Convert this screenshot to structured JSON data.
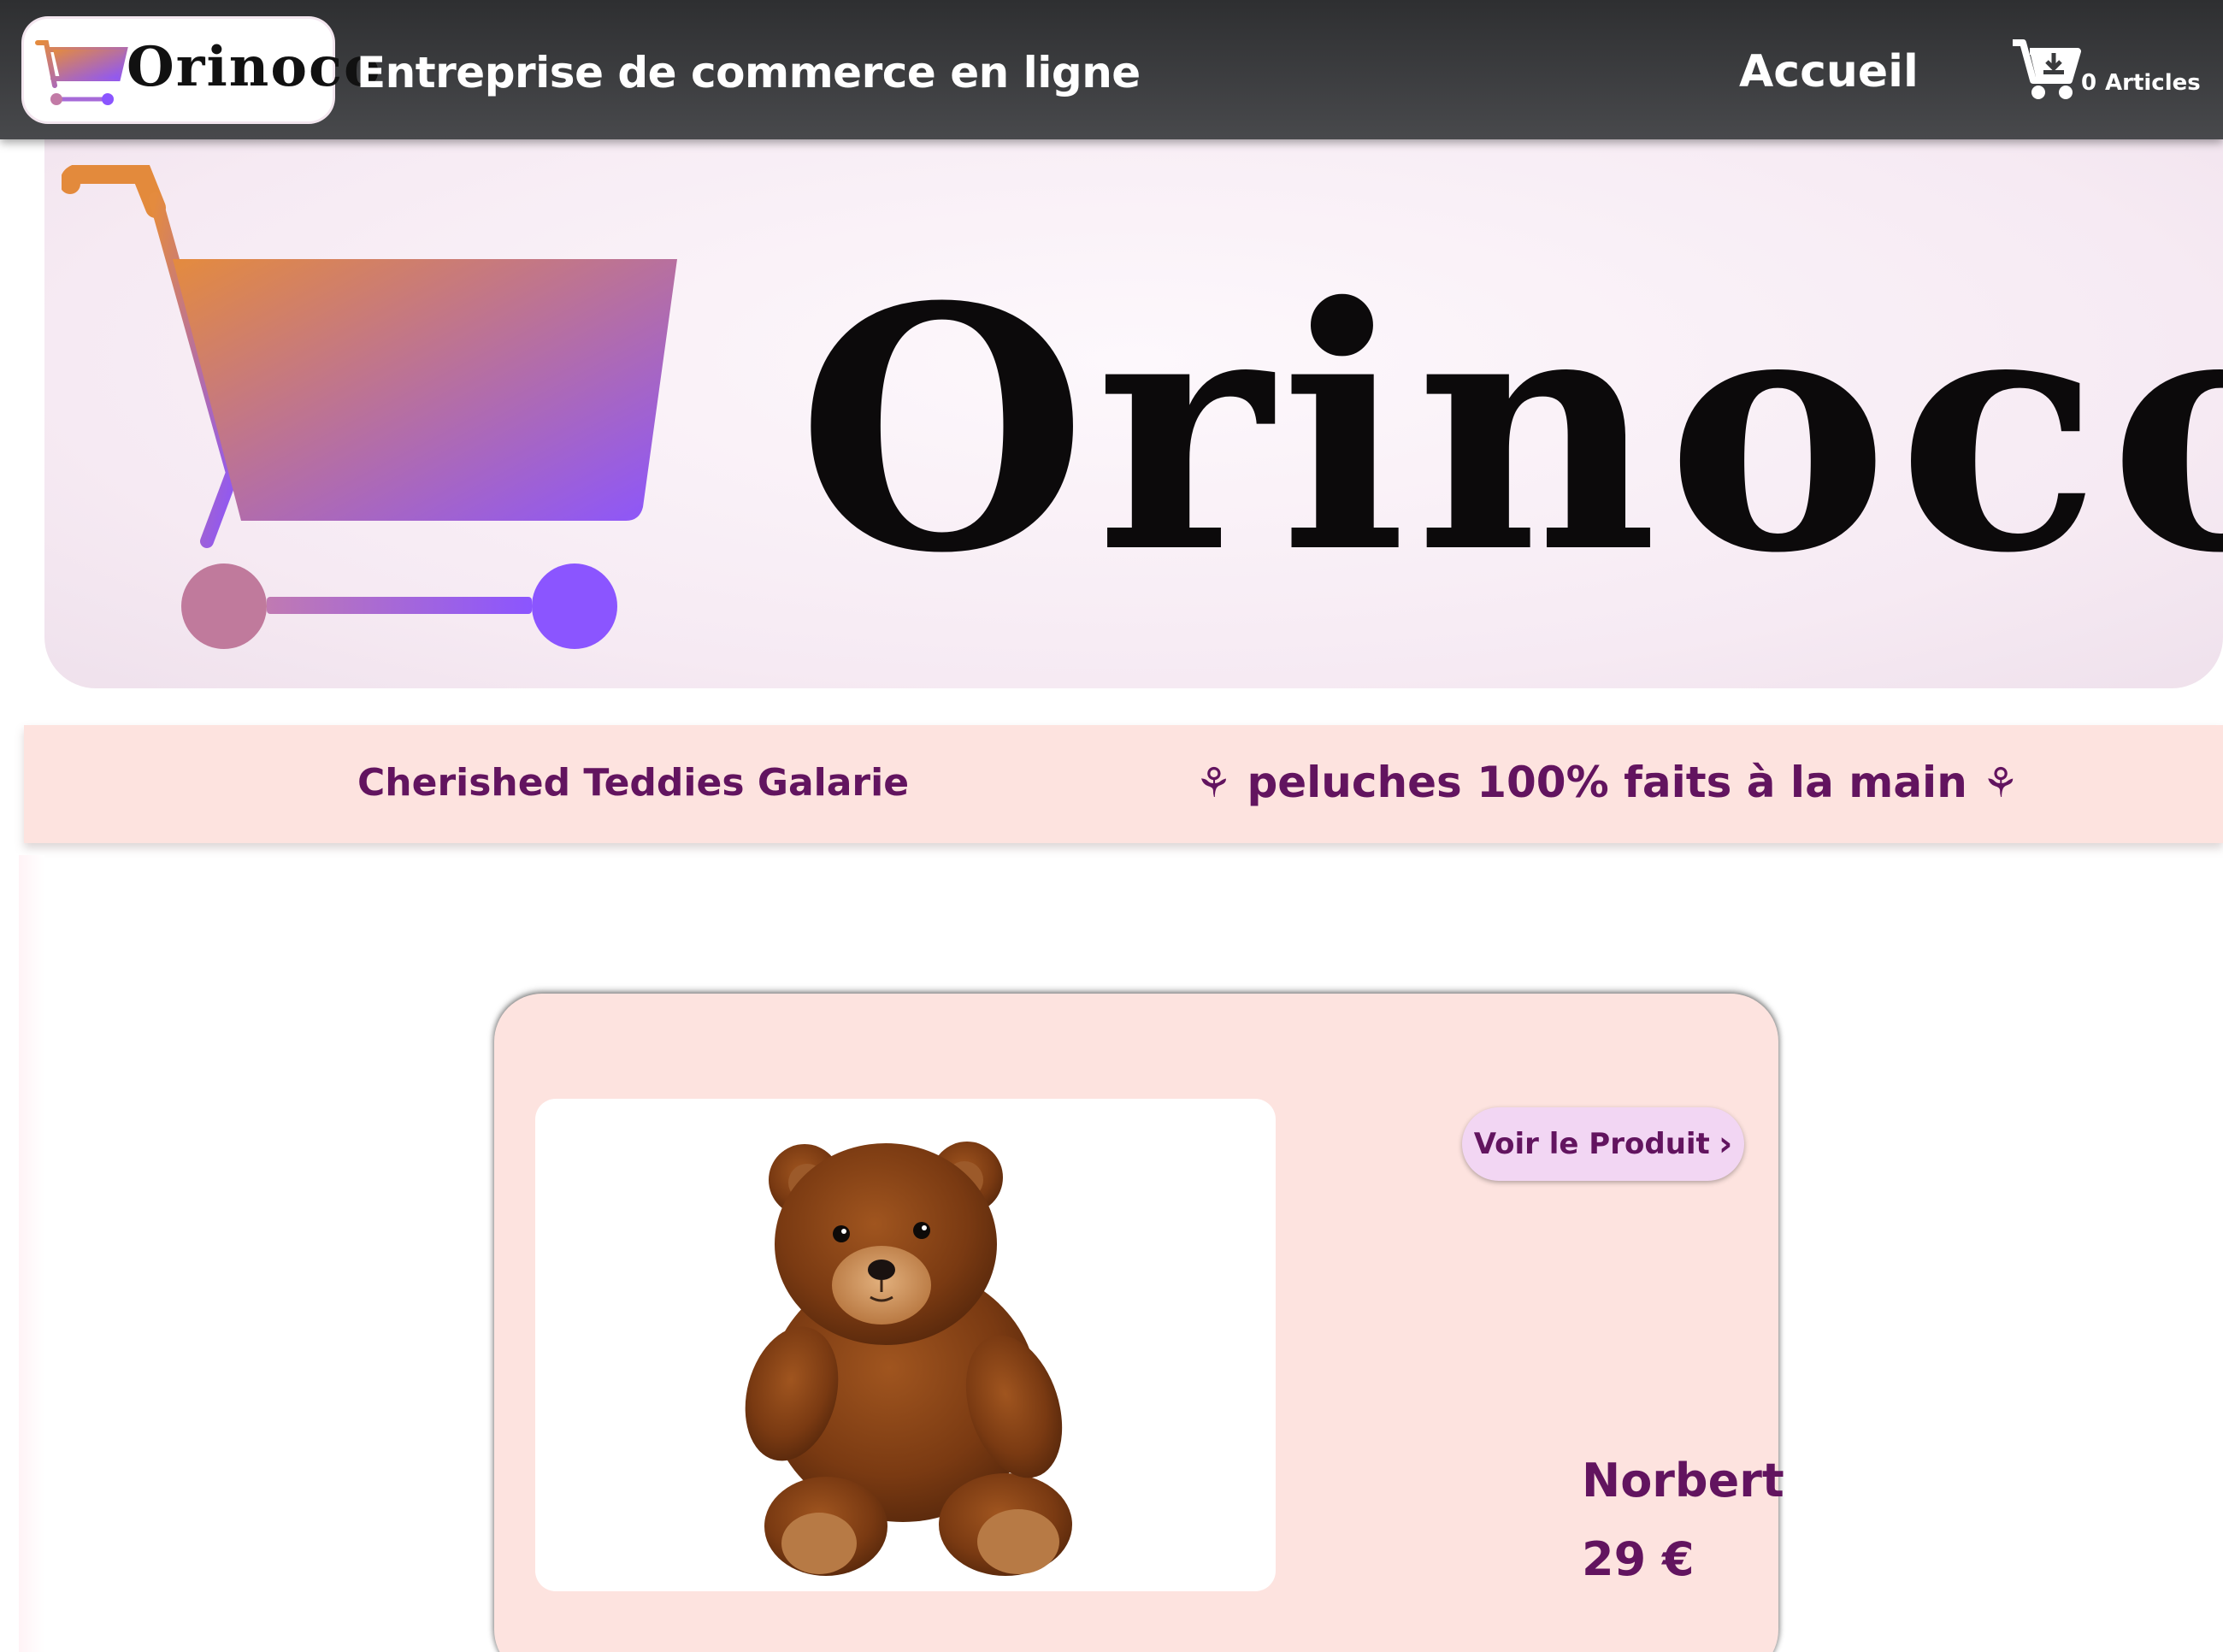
{
  "header": {
    "logo_text": "Orinoco",
    "tagline": "Entreprise de commerce en ligne",
    "nav_home": "Accueil",
    "cart_count": "0",
    "cart_label": "Articles"
  },
  "hero": {
    "brand": "Orinoco"
  },
  "band": {
    "gallery_name": "Cherished Teddies Galarie",
    "slogan": "peluches 100% faits à la main",
    "leaf_glyph": "⚘"
  },
  "product": {
    "button_label": "Voir le Produit",
    "name": "Norbert",
    "price": "29 €",
    "image_icon": "teddy-bear-photo"
  },
  "colors": {
    "topbar": "#3a3b3d",
    "accent_text": "#62145f",
    "band_bg": "#fde3df",
    "button_bg": "#f2d6f3",
    "cart_gradient_start": "#e48b3e",
    "cart_gradient_end": "#8b55ff"
  }
}
